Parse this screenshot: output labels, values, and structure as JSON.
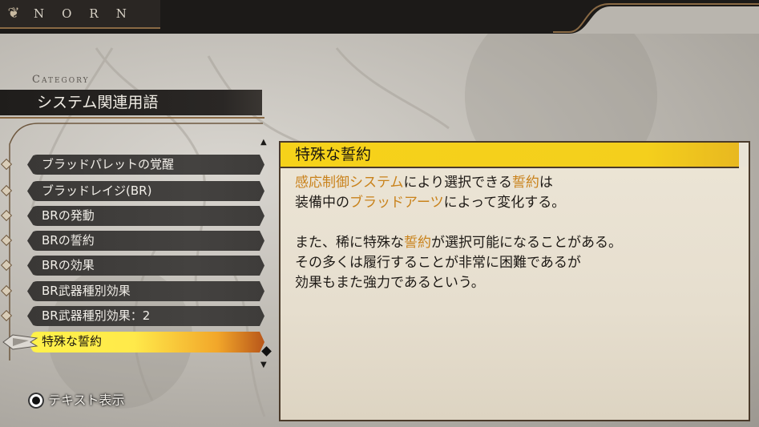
{
  "header": {
    "logo_icon": "leaf-emblem-icon",
    "brand": "NORN"
  },
  "category": {
    "label": "Category",
    "value": "システム関連用語"
  },
  "list": {
    "items": [
      {
        "label": "ブラッドパレットの覚醒",
        "selected": false
      },
      {
        "label": "ブラッドレイジ(BR)",
        "selected": false
      },
      {
        "label": "BRの発動",
        "selected": false
      },
      {
        "label": "BRの誓約",
        "selected": false
      },
      {
        "label": "BRの効果",
        "selected": false
      },
      {
        "label": "BR武器種別効果",
        "selected": false
      },
      {
        "label": "BR武器種別効果：2",
        "selected": false
      },
      {
        "label": "特殊な誓約",
        "selected": true
      }
    ]
  },
  "detail": {
    "title": "特殊な誓約",
    "line1_a": "感応制御システム",
    "line1_b": "により選択できる",
    "line1_c": "誓約",
    "line1_d": "は",
    "line2_a": "装備中の",
    "line2_b": "ブラッドアーツ",
    "line2_c": "によって変化する。",
    "line3_a": "また、稀に特殊な",
    "line3_b": "誓約",
    "line3_c": "が選択可能になることがある。",
    "line4": "その多くは履行することが非常に困難であるが",
    "line5": "効果もまた強力であるという。"
  },
  "footer": {
    "button_icon": "circle-button-icon",
    "hint": "テキスト表示"
  },
  "colors": {
    "highlight": "#c9821b",
    "selected_bar": "#fff24a",
    "title_bar": "#f6d21a"
  }
}
